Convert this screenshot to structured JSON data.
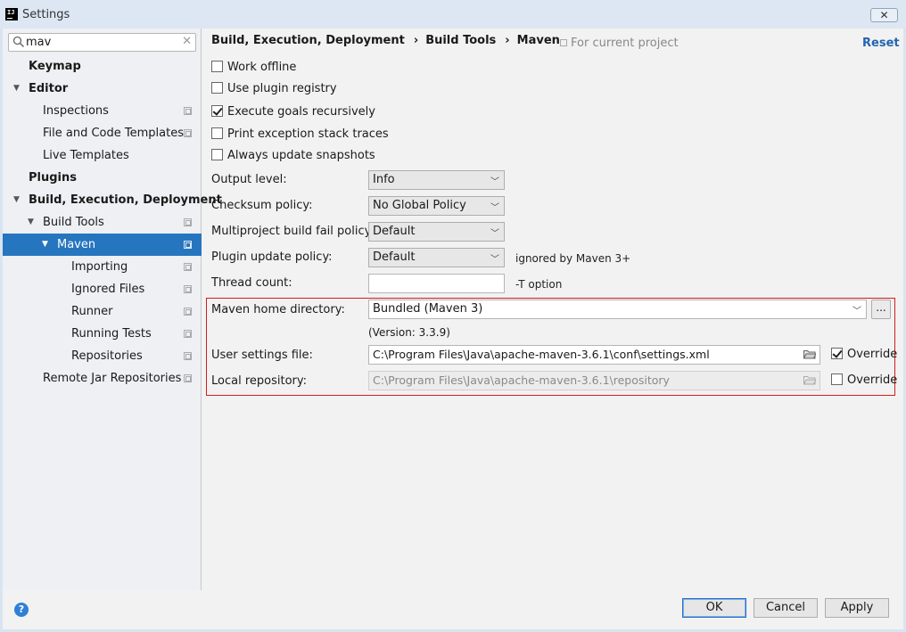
{
  "window": {
    "title": "Settings",
    "close_glyph": "✕"
  },
  "search": {
    "value": "mav",
    "clear_glyph": "✕"
  },
  "sidebar": {
    "items": [
      {
        "label": "Keymap",
        "bold": true,
        "level": 0,
        "arrow": ""
      },
      {
        "label": "Editor",
        "bold": true,
        "level": 0,
        "arrow": "▼"
      },
      {
        "label": "Inspections",
        "level": 1,
        "copy": true
      },
      {
        "label": "File and Code Templates",
        "level": 1,
        "copy": true
      },
      {
        "label": "Live Templates",
        "level": 1
      },
      {
        "label": "Plugins",
        "bold": true,
        "level": 0
      },
      {
        "label": "Build, Execution, Deployment",
        "bold": true,
        "level": 0,
        "arrow": "▼"
      },
      {
        "label": "Build Tools",
        "level": 1,
        "arrow": "▼",
        "copy": true
      },
      {
        "label": "Maven",
        "level": 2,
        "arrow": "▼",
        "copy": true,
        "selected": true
      },
      {
        "label": "Importing",
        "level": 3,
        "copy": true
      },
      {
        "label": "Ignored Files",
        "level": 3,
        "copy": true
      },
      {
        "label": "Runner",
        "level": 3,
        "copy": true
      },
      {
        "label": "Running Tests",
        "level": 3,
        "copy": true
      },
      {
        "label": "Repositories",
        "level": 3,
        "copy": true
      },
      {
        "label": "Remote Jar Repositories",
        "level": 1,
        "copy": true
      }
    ]
  },
  "breadcrumb": {
    "parts": [
      "Build, Execution, Deployment",
      "Build Tools",
      "Maven"
    ],
    "separator": "›"
  },
  "for_current_project": "For current project",
  "reset_label": "Reset",
  "options": {
    "work_offline": {
      "label": "Work offline",
      "checked": false
    },
    "use_plugin_registry": {
      "label": "Use plugin registry",
      "checked": false
    },
    "execute_goals_recursively": {
      "label": "Execute goals recursively",
      "checked": true
    },
    "print_exception_stack_traces": {
      "label": "Print exception stack traces",
      "checked": false
    },
    "always_update_snapshots": {
      "label": "Always update snapshots",
      "checked": false
    }
  },
  "fields": {
    "output_level": {
      "label": "Output level:",
      "value": "Info"
    },
    "checksum_policy": {
      "label": "Checksum policy:",
      "value": "No Global Policy"
    },
    "multiproject_fail_policy": {
      "label": "Multiproject build fail policy:",
      "value": "Default"
    },
    "plugin_update_policy": {
      "label": "Plugin update policy:",
      "value": "Default",
      "hint": "ignored by Maven 3+"
    },
    "thread_count": {
      "label": "Thread count:",
      "value": "",
      "hint": "-T option"
    },
    "maven_home": {
      "label": "Maven home directory:",
      "value": "Bundled (Maven 3)",
      "version": "(Version: 3.3.9)",
      "browse_label": "..."
    },
    "user_settings": {
      "label": "User settings file:",
      "value": "C:\\Program Files\\Java\\apache-maven-3.6.1\\conf\\settings.xml",
      "override_label": "Override",
      "override": true
    },
    "local_repository": {
      "label": "Local repository:",
      "value": "C:\\Program Files\\Java\\apache-maven-3.6.1\\repository",
      "override_label": "Override",
      "override": false
    }
  },
  "footer": {
    "help_glyph": "?",
    "ok_label": "OK",
    "cancel_label": "Cancel",
    "apply_label": "Apply"
  },
  "colors": {
    "selection": "#2675bf",
    "highlight_border": "#d11d1d",
    "link": "#2265b0"
  }
}
